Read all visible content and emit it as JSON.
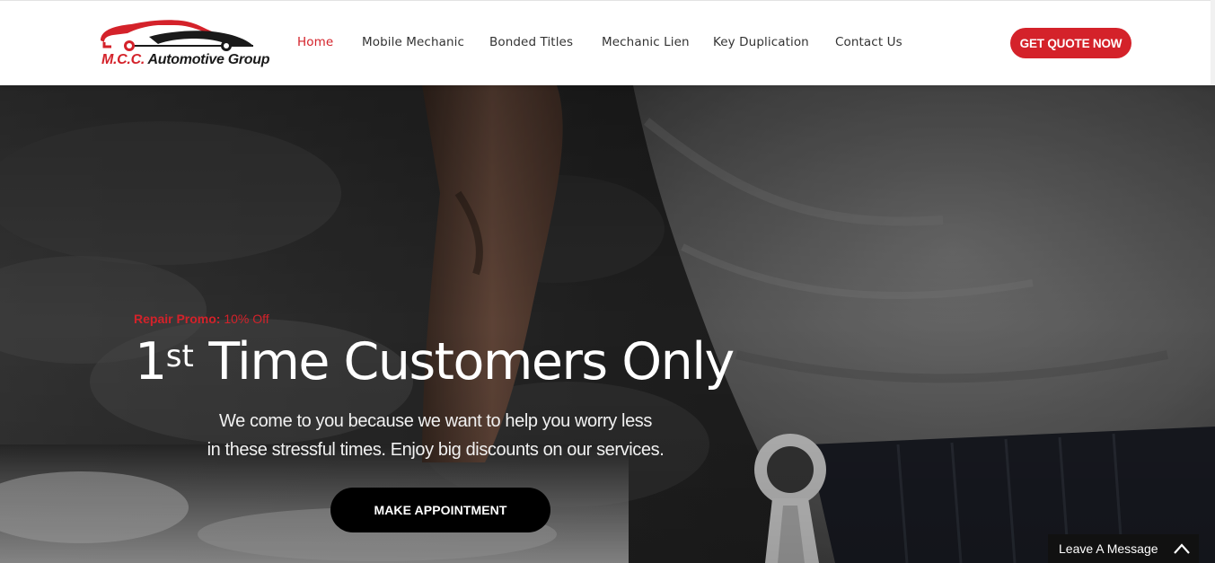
{
  "brand": {
    "logo_text_prefix": "M.C.C.",
    "logo_text_suffix": "Automotive Group",
    "accent_color": "#d4222a"
  },
  "nav": {
    "items": [
      {
        "label": "Home",
        "active": true
      },
      {
        "label": "Mobile Mechanic",
        "active": false
      },
      {
        "label": "Bonded Titles",
        "active": false
      },
      {
        "label": "Mechanic Lien",
        "active": false
      },
      {
        "label": "Key Duplication",
        "active": false
      },
      {
        "label": "Contact Us",
        "active": false
      }
    ],
    "cta_label": "GET QUOTE NOW"
  },
  "hero": {
    "promo_bold": "Repair Promo:",
    "promo_rest": " 10% Off",
    "headline_number": "1",
    "headline_superscript": "st",
    "headline_rest": " Time Customers Only",
    "subtext_line1": "We come to you because we want to help you worry less",
    "subtext_line2": "in these stressful times. Enjoy big discounts on our services.",
    "button_label": "MAKE APPOINTMENT"
  },
  "chat": {
    "label": "Leave A Message",
    "icon": "chevron-up-icon"
  }
}
